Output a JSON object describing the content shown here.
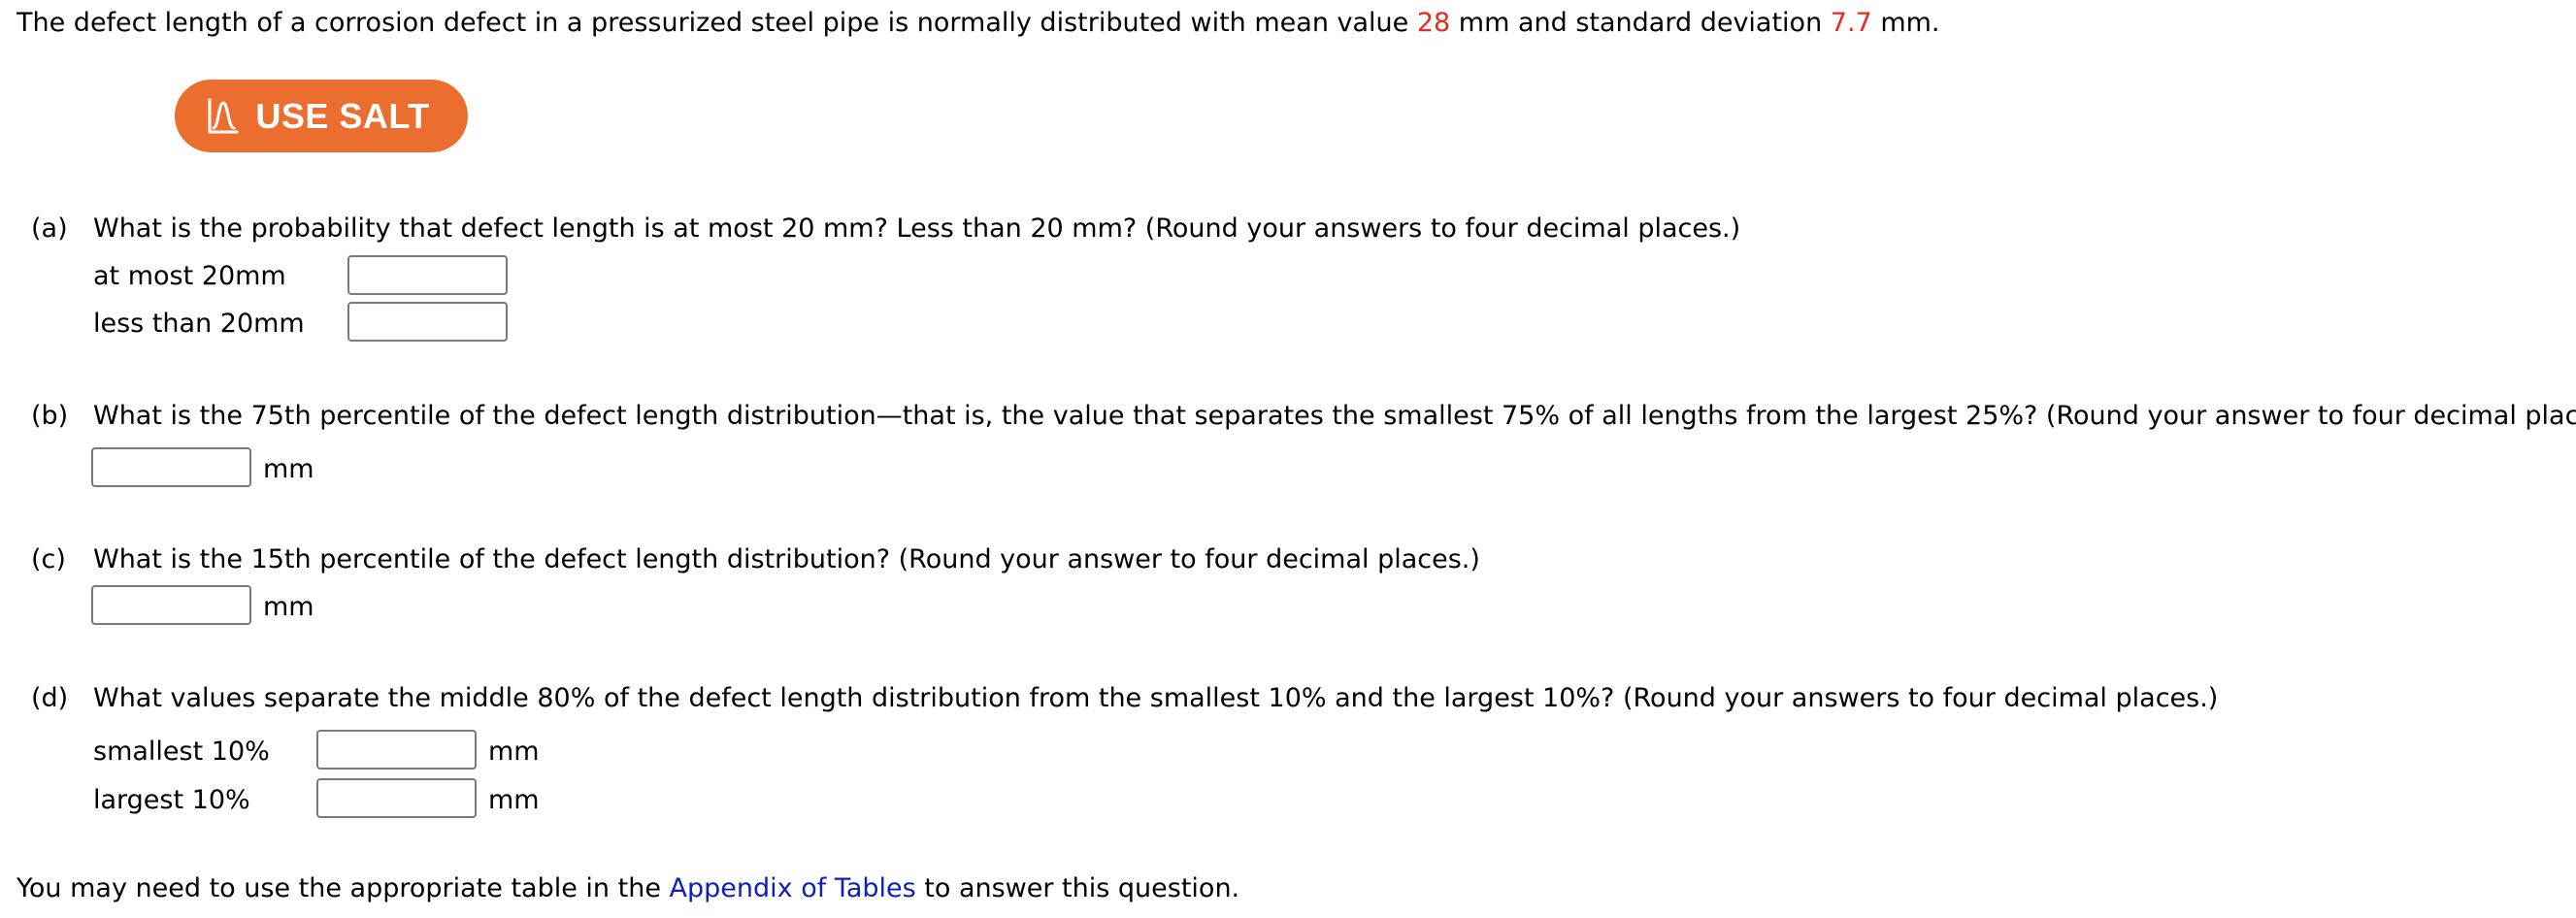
{
  "intro": {
    "text_before_mean": "The defect length of a corrosion defect in a pressurized steel pipe is normally distributed with mean value ",
    "mean_value": "28",
    "text_between": " mm and standard deviation ",
    "sd_value": "7.7",
    "text_after": " mm."
  },
  "salt_button": {
    "icon": "normal-curve-icon",
    "label": "USE SALT",
    "color": "#eb6e2f"
  },
  "parts": {
    "a": {
      "marker": "(a)",
      "question": "What is the probability that defect length is at most 20 mm? Less than 20 mm? (Round your answers to four decimal places.)",
      "fields": [
        {
          "label": "at most 20mm",
          "value": ""
        },
        {
          "label": "less than 20mm",
          "value": ""
        }
      ]
    },
    "b": {
      "marker": "(b)",
      "question": "What is the 75th percentile of the defect length distribution—that is, the value that separates the smallest 75% of all lengths from the largest 25%? (Round your answer to four decimal places.)",
      "field": {
        "value": "",
        "unit": "mm"
      }
    },
    "c": {
      "marker": "(c)",
      "question": "What is the 15th percentile of the defect length distribution? (Round your answer to four decimal places.)",
      "field": {
        "value": "",
        "unit": "mm"
      }
    },
    "d": {
      "marker": "(d)",
      "question": "What values separate the middle 80% of the defect length distribution from the smallest 10% and the largest 10%? (Round your answers to four decimal places.)",
      "fields": [
        {
          "label": "smallest 10%",
          "value": "",
          "unit": "mm"
        },
        {
          "label": "largest 10%",
          "value": "",
          "unit": "mm"
        }
      ]
    }
  },
  "footer": {
    "text_before": "You may need to use the appropriate table in the ",
    "link_label": "Appendix of Tables",
    "text_after": " to answer this question."
  },
  "colors": {
    "highlight_red": "#e8291c",
    "link_blue": "#1020b4"
  }
}
